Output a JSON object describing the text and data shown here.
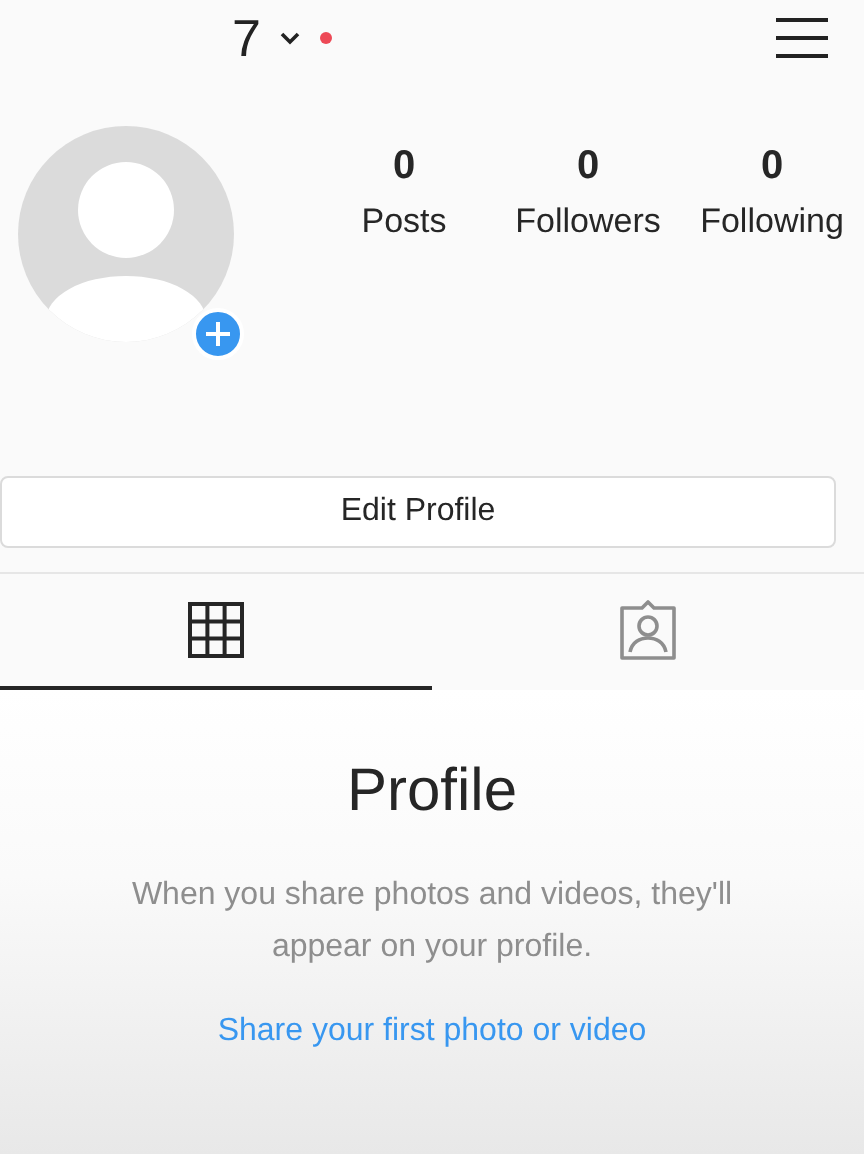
{
  "header": {
    "username": "7",
    "notification_dot": true
  },
  "stats": [
    {
      "value": "0",
      "label": "Posts"
    },
    {
      "value": "0",
      "label": "Followers"
    },
    {
      "value": "0",
      "label": "Following"
    }
  ],
  "edit_button": "Edit Profile",
  "tabs": [
    {
      "kind": "grid",
      "selected": true
    },
    {
      "kind": "tagged",
      "selected": false
    }
  ],
  "empty_state": {
    "title": "Profile",
    "body": "When you share photos and videos, they'll appear on your profile.",
    "link": "Share your first photo or video"
  }
}
